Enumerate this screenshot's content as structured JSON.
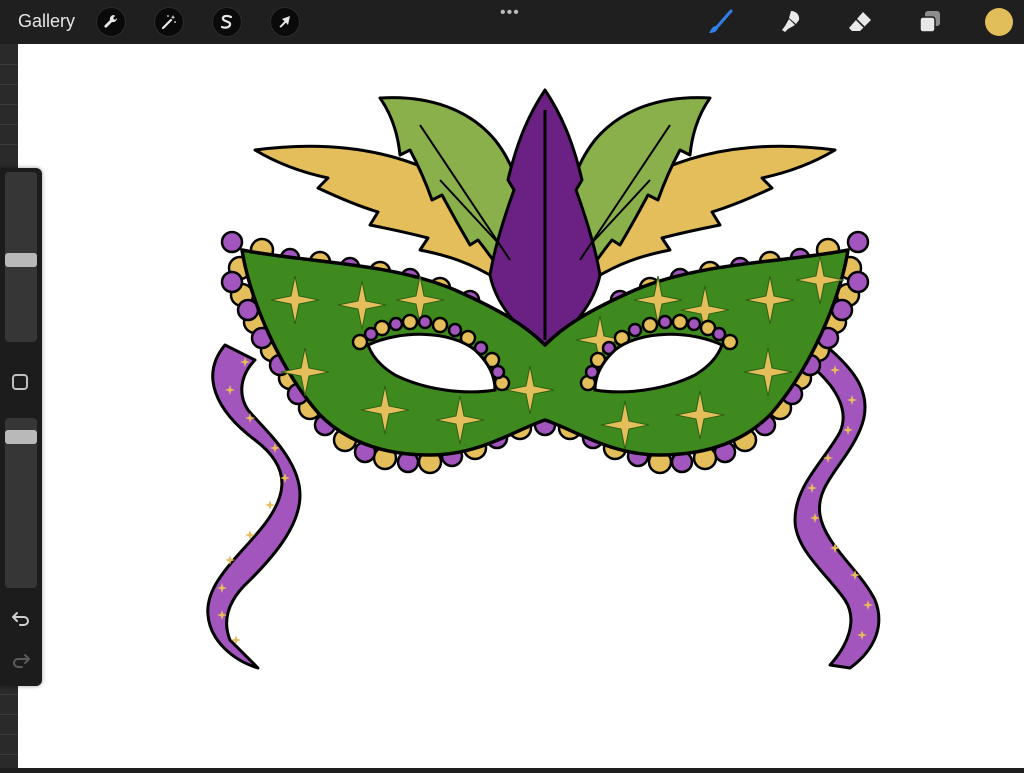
{
  "toolbar": {
    "gallery_label": "Gallery",
    "left_tools": [
      {
        "icon": "wrench-icon",
        "name": "actions-button"
      },
      {
        "icon": "magic-wand-icon",
        "name": "adjustments-button"
      },
      {
        "icon": "selection-s-icon",
        "name": "selection-button"
      },
      {
        "icon": "arrow-cursor-icon",
        "name": "transform-button"
      }
    ],
    "more_label": "•••",
    "right_tools": [
      {
        "icon": "brush-icon",
        "name": "brush-tool",
        "active": true
      },
      {
        "icon": "smudge-icon",
        "name": "smudge-tool"
      },
      {
        "icon": "eraser-icon",
        "name": "eraser-tool"
      },
      {
        "icon": "layers-icon",
        "name": "layers-button"
      }
    ],
    "current_color": "#E2BE5A",
    "active_accent": "#2F7FE6"
  },
  "sidebar": {
    "brush_size_level": 0.48,
    "opacity_level": 0.08,
    "modify_icon": "square-outline-icon",
    "undo_icon": "undo-icon",
    "redo_icon": "redo-icon"
  },
  "artwork": {
    "subject": "mardi-gras-mask",
    "colors": {
      "mask_green": "#3E8A1E",
      "gold": "#E4BE5B",
      "purple_dark": "#6A2183",
      "purple_light": "#A355BE",
      "feather_green": "#89B04A",
      "outline": "#000000"
    }
  }
}
